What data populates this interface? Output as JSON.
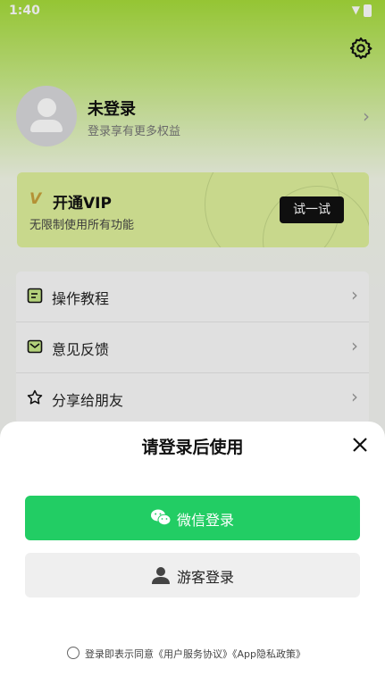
{
  "status_bar": {
    "time": "1:40"
  },
  "profile": {
    "name": "未登录",
    "subtitle": "登录享有更多权益"
  },
  "vip": {
    "badge": "VIP",
    "title": "开通VIP",
    "subtitle": "无限制使用所有功能",
    "button": "试一试"
  },
  "menu": {
    "items": [
      {
        "label": "操作教程",
        "icon": "tutorial-icon"
      },
      {
        "label": "意见反馈",
        "icon": "feedback-icon"
      },
      {
        "label": "分享给朋友",
        "icon": "star-icon"
      }
    ]
  },
  "login_sheet": {
    "title": "请登录后使用",
    "wechat_button": "微信登录",
    "guest_button": "游客登录",
    "agreement": "登录即表示同意《用户服务协议》《App隐私政策》"
  },
  "colors": {
    "accent_green": "#22cd64",
    "vip_bg": "#dff19c",
    "header_green": "#a6dc3a"
  }
}
